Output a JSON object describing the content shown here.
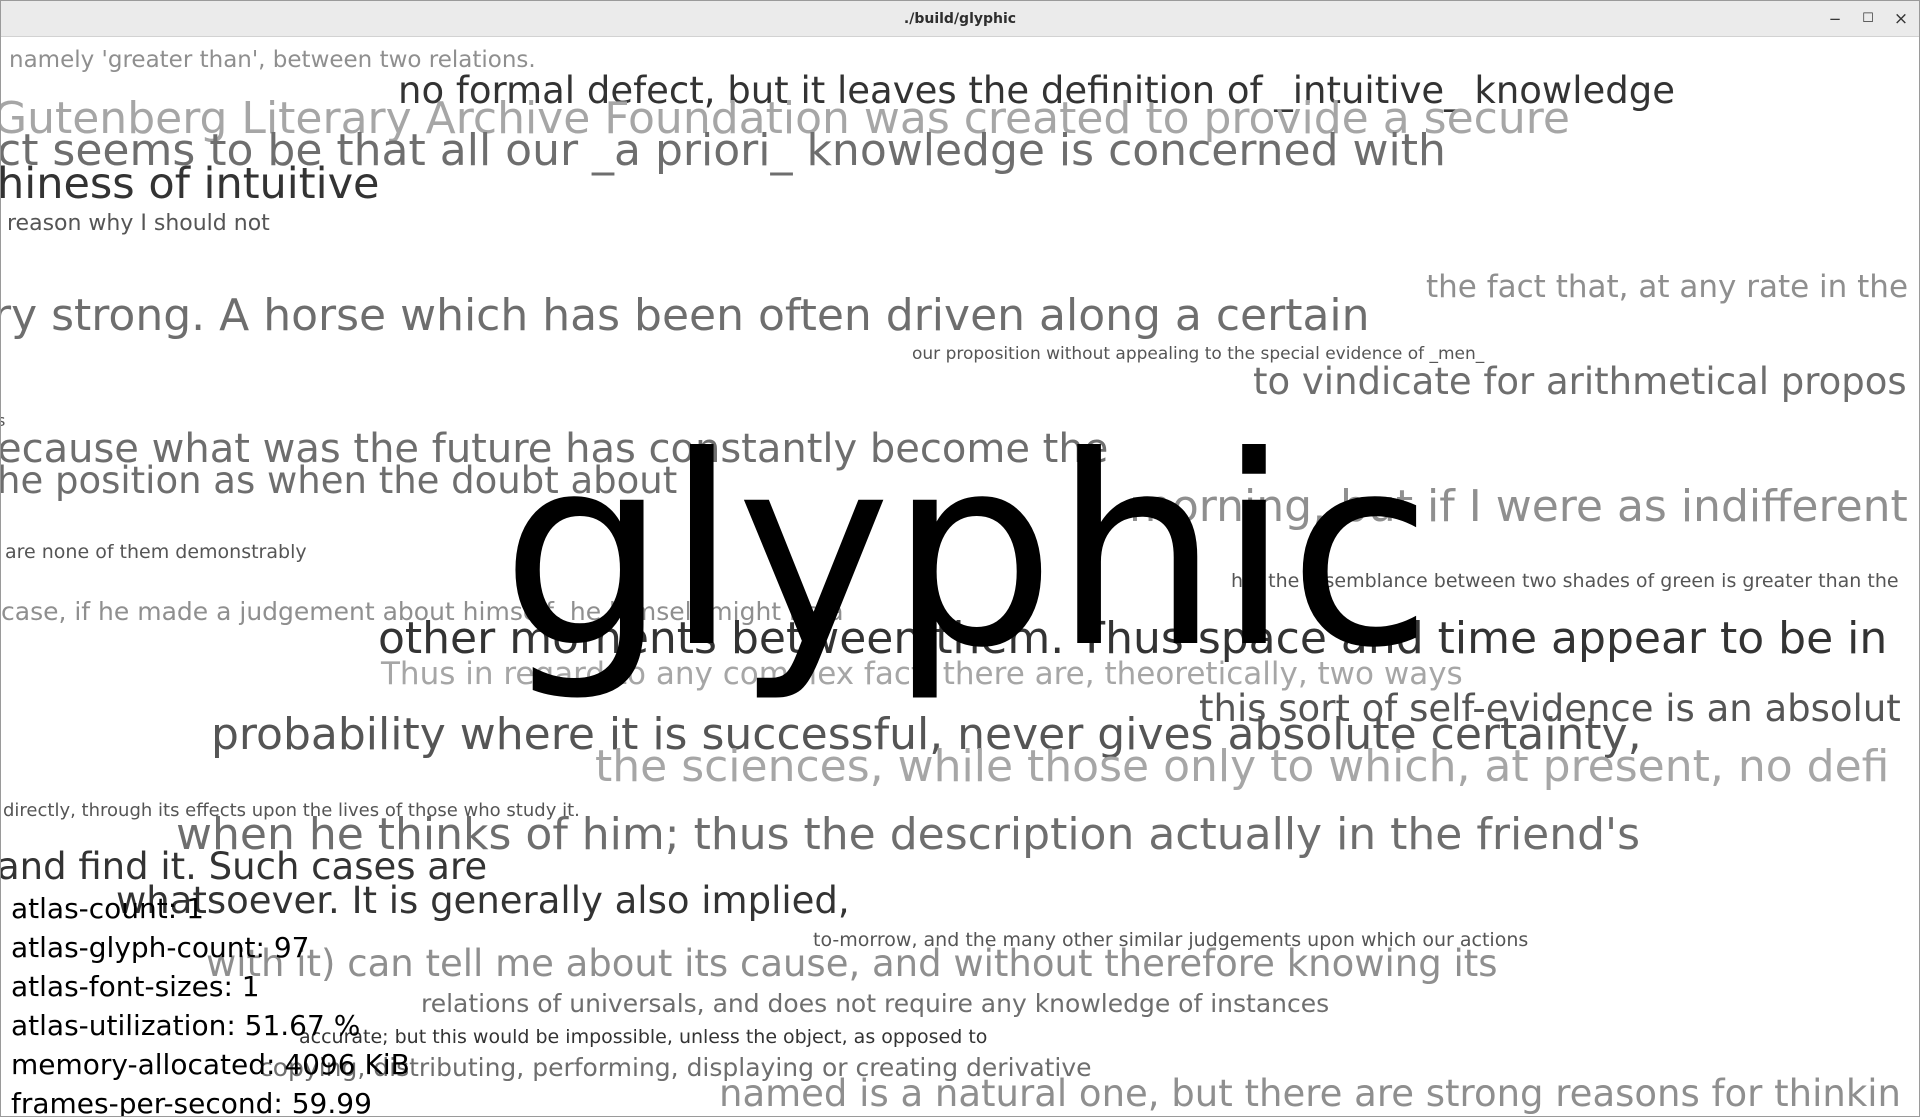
{
  "window": {
    "title": "./build/glyphic",
    "buttons": {
      "minimize": "−",
      "maximize": "☐",
      "close": "×"
    }
  },
  "logo": "glyphic",
  "background_text": [
    "namely 'greater than', between two relations.",
    "no formal defect, but it leaves the definition of _intuitive_ knowledge",
    "Gutenberg Literary Archive Foundation was created to provide a secure",
    "ct seems to be that all our _a priori_ knowledge is concerned with",
    "hiness of intuitive",
    "reason why I should not",
    "the fact that, at any rate in the",
    "ry strong. A horse which has been often driven along a certain",
    "our proposition without appealing to the special evidence of _men_",
    "to vindicate for arithmetical propos",
    "s",
    "ecause what was the future has constantly become the",
    "he position as when the doubt about",
    "morning, but if I were as indifferent",
    "are none of them demonstrably",
    "hat the resemblance between two shades of green is greater than the",
    "case, if he made a judgement about himself, he himself might be a",
    "other moments between them. Thus space and time appear to be in",
    "Thus in regard to any complex fact, there are, theoretically, two ways",
    "this sort of self-evidence is an absolut",
    "probability where it is successful, never gives absolute certainty,",
    "the sciences, while those only to which, at present, no defi",
    "directly, through its effects upon the lives of those who study it.",
    "when he thinks of him; thus the description actually in the friend's",
    "and find it. Such cases are",
    "whatsoever. It is generally also implied,",
    "to-morrow, and the many other similar judgements upon which our actions",
    "with it) can tell me about its cause, and without therefore knowing its",
    "relations of universals, and does not require any knowledge of instances",
    "accurate; but this would be impossible, unless the object, as opposed to",
    "copying, distributing, performing, displaying or creating derivative",
    "named is a natural one, but there are strong reasons for thinkin"
  ],
  "stats": {
    "atlas_count": "atlas-count: 1",
    "atlas_glyph_count": "atlas-glyph-count: 97",
    "atlas_font_sizes": "atlas-font-sizes: 1",
    "atlas_utilization": "atlas-utilization: 51.67 %",
    "memory_allocated": "memory-allocated: 4096 KiB",
    "frames_per_second": "frames-per-second: 59.99"
  }
}
